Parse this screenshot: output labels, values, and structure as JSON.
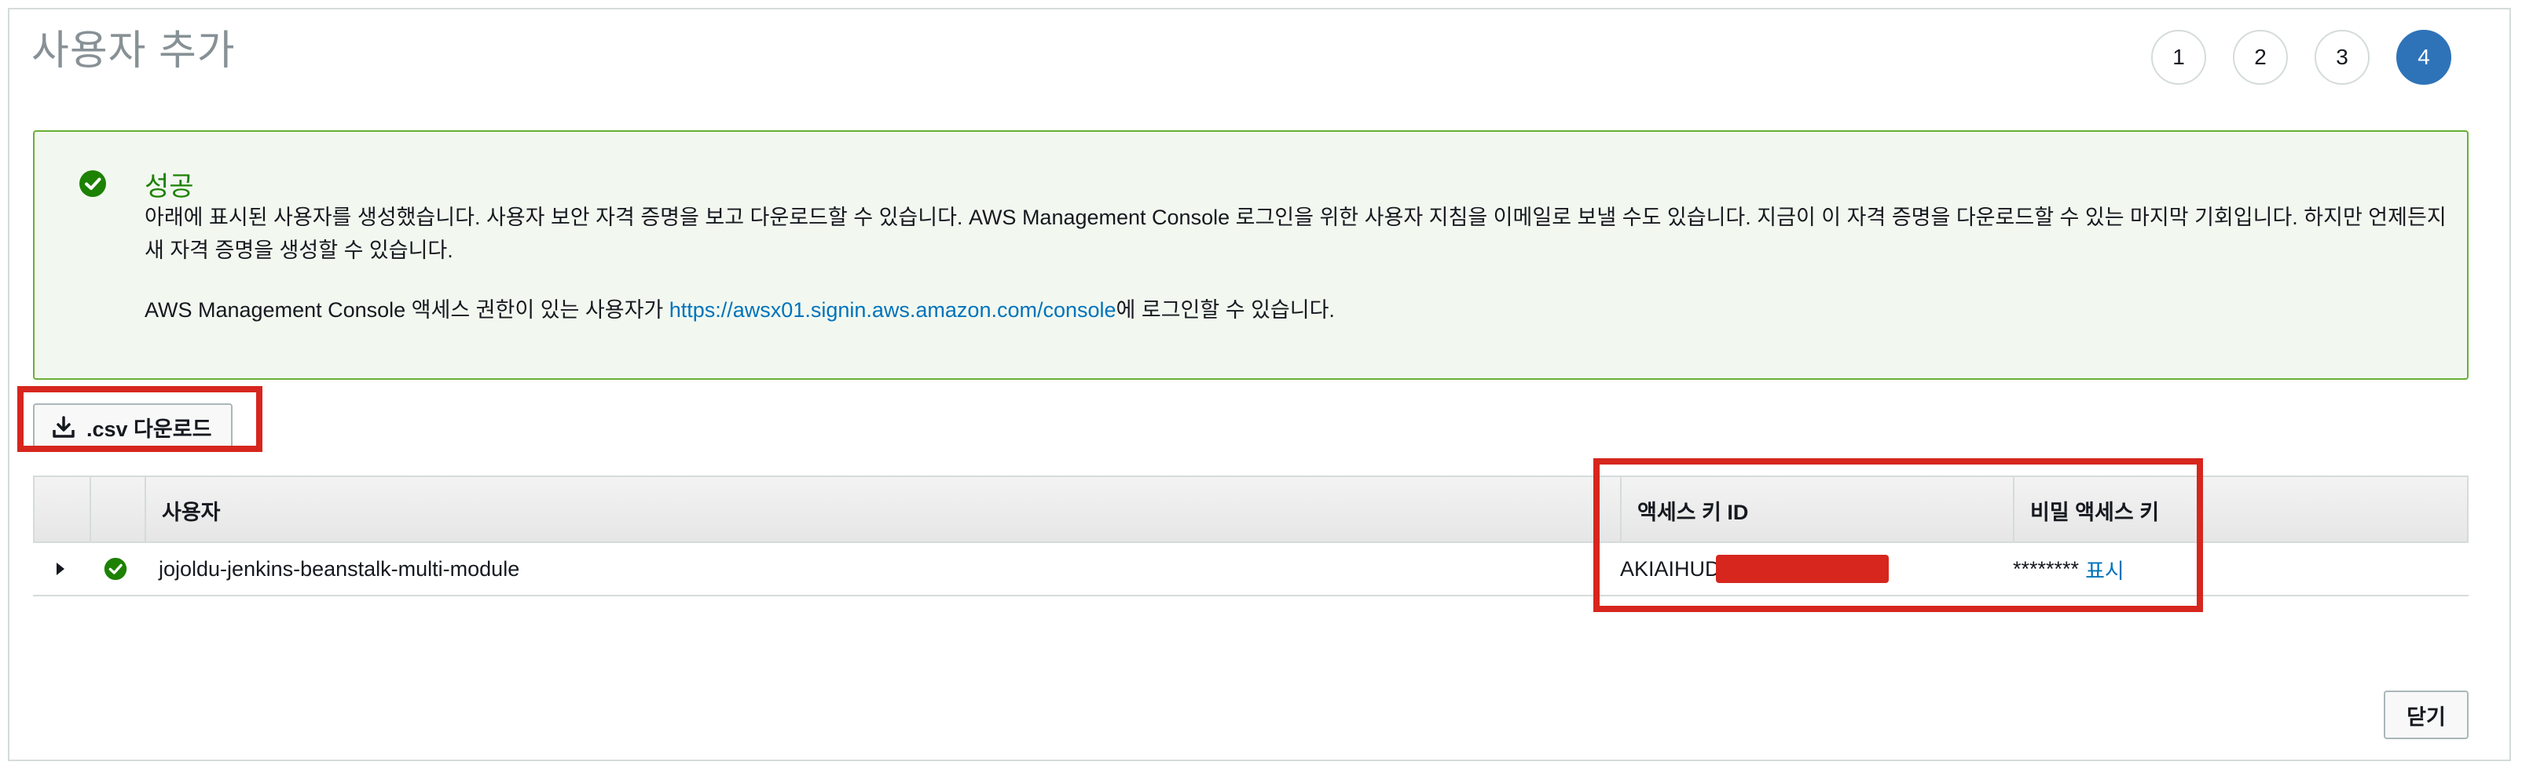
{
  "page": {
    "title": "사용자 추가"
  },
  "steps": [
    "1",
    "2",
    "3",
    "4"
  ],
  "active_step": "4",
  "success": {
    "title": "성공",
    "message": "아래에 표시된 사용자를 생성했습니다. 사용자 보안 자격 증명을 보고 다운로드할 수 있습니다. AWS Management Console 로그인을 위한 사용자 지침을 이메일로 보낼 수도 있습니다. 지금이 이 자격 증명을 다운로드할 수 있는 마지막 기회입니다. 하지만 언제든지 새 자격 증명을 생성할 수 있습니다.",
    "console_prefix": "AWS Management Console 액세스 권한이 있는 사용자가 ",
    "console_link": "https://awsx01.signin.aws.amazon.com/console",
    "console_suffix": "에 로그인할 수 있습니다."
  },
  "toolbar": {
    "csv_download_label": ".csv 다운로드"
  },
  "table": {
    "headers": {
      "user": "사용자",
      "access_key_id": "액세스 키 ID",
      "secret_key": "비밀 액세스 키"
    },
    "rows": [
      {
        "user": "jojoldu-jenkins-beanstalk-multi-module",
        "access_key_id": "AKIAIHUD",
        "secret_key": "********",
        "show_label": "표시"
      }
    ]
  },
  "footer": {
    "close_label": "닫기"
  },
  "colors": {
    "primary": "#2e73b8",
    "success": "#1d8102",
    "highlight": "#d6261e",
    "link": "#0073bb"
  }
}
